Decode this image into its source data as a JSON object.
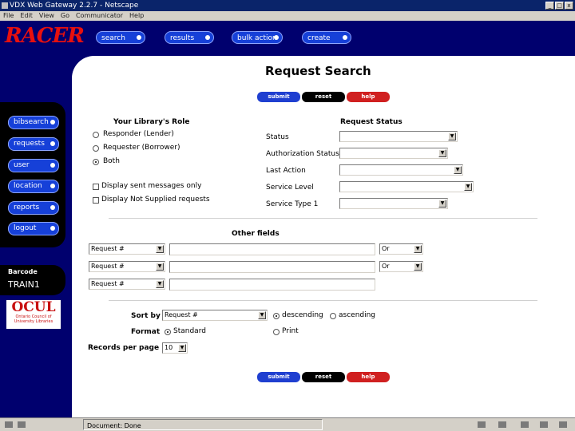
{
  "window": {
    "title": "VDX Web Gateway 2.2.7 - Netscape",
    "controls": [
      "_",
      "□",
      "x"
    ]
  },
  "menu": [
    "File",
    "Edit",
    "View",
    "Go",
    "Communicator",
    "Help"
  ],
  "logo": "RACER",
  "topnav": [
    "search",
    "results",
    "bulk action",
    "create"
  ],
  "sidenav": [
    "bibsearch",
    "requests",
    "user",
    "location",
    "reports",
    "logout"
  ],
  "barcode": {
    "label": "Barcode",
    "value": "TRAIN1"
  },
  "ocul": {
    "name": "OCUL",
    "sub1": "Ontario Council of",
    "sub2": "University Libraries"
  },
  "page": {
    "title": "Request Search"
  },
  "buttons": {
    "submit": "submit",
    "reset": "reset",
    "help": "help"
  },
  "role": {
    "heading": "Your Library's Role",
    "options": [
      "Responder (Lender)",
      "Requester (Borrower)",
      "Both"
    ],
    "selected": "Both"
  },
  "checkboxes": [
    "Display sent messages only",
    "Display Not Supplied requests"
  ],
  "status": {
    "heading": "Request Status",
    "fields": [
      "Status",
      "Authorization Status",
      "Last Action",
      "Service Level",
      "Service Type 1"
    ]
  },
  "other": {
    "heading": "Other fields",
    "rows": [
      {
        "field": "Request #",
        "op": "Or"
      },
      {
        "field": "Request #",
        "op": "Or"
      },
      {
        "field": "Request #",
        "op": ""
      }
    ]
  },
  "sort": {
    "label": "Sort by",
    "value": "Request #",
    "orders": [
      "descending",
      "ascending"
    ],
    "selected": "descending"
  },
  "format": {
    "label": "Format",
    "options": [
      "Standard",
      "Print"
    ],
    "selected": "Standard"
  },
  "records": {
    "label": "Records per page",
    "value": "10"
  },
  "statusbar": {
    "text": "Document: Done"
  }
}
